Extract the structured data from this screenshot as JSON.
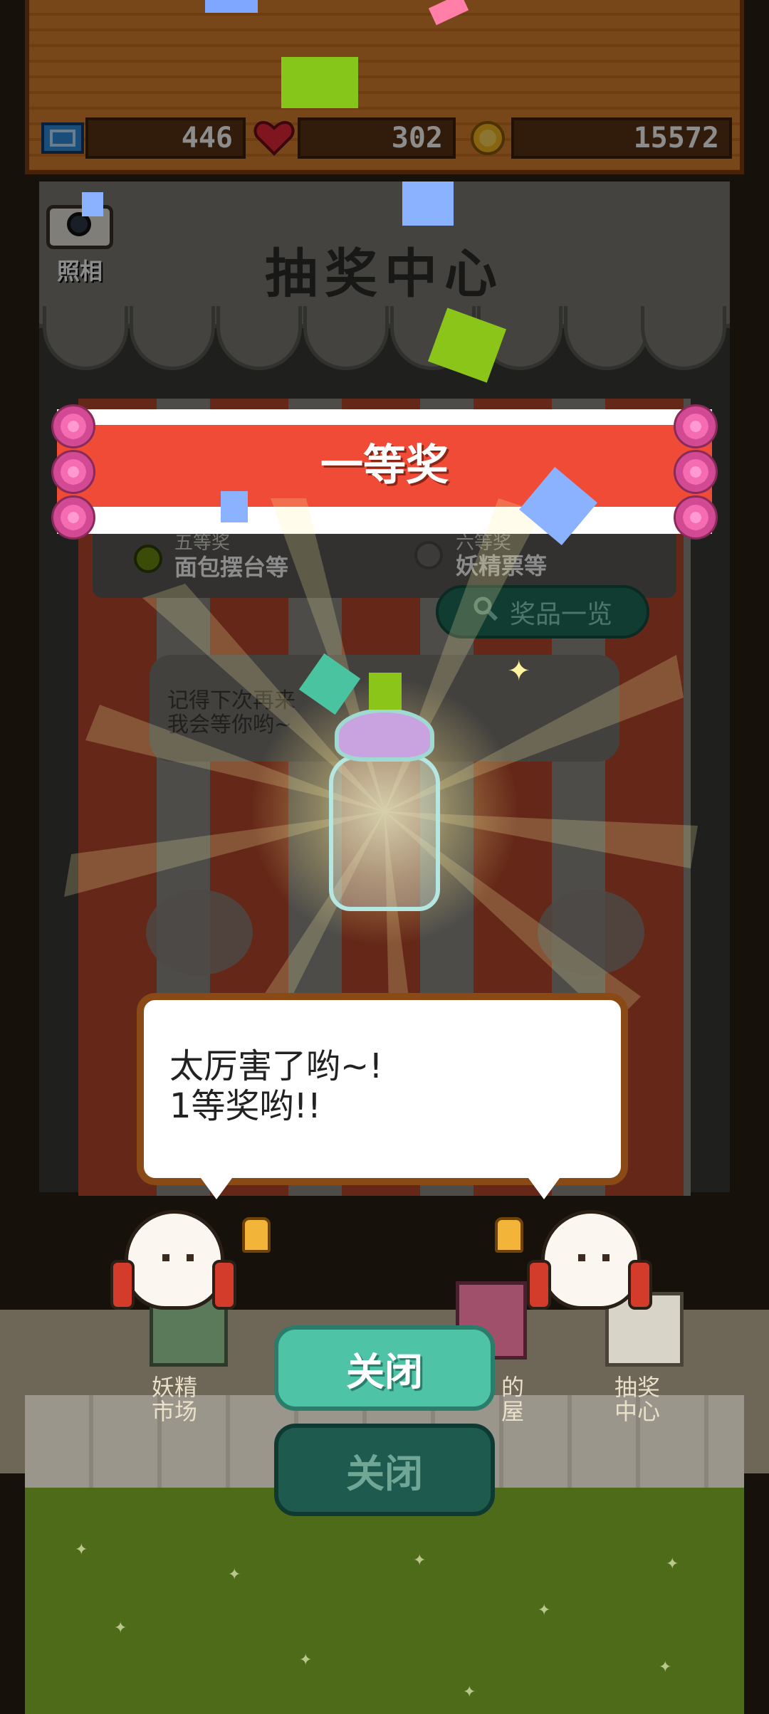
{
  "resources": {
    "tickets": "446",
    "hearts": "302",
    "coins": "15572"
  },
  "camera_label": "照相",
  "awning_title": "抽奖中心",
  "prize_banner": "一等奖",
  "prize_info": {
    "fifth": {
      "tier": "五等奖",
      "item": "面包摆台等"
    },
    "sixth": {
      "tier": "六等奖",
      "item": "妖精票等"
    }
  },
  "prize_list_button": "奖品一览",
  "hint_text": "记得下次再来\n我会等你哟~",
  "dialog_text": "太厉害了哟~!\n1等奖哟!!",
  "buildings": {
    "left": "妖精\n市场",
    "middle": "的\n屋",
    "right": "抽奖\n中心"
  },
  "buttons": {
    "close": "关闭",
    "close_secondary": "关闭"
  },
  "colors": {
    "banner_red": "#ef4b37",
    "button_teal": "#4ec3a6",
    "wood": "#d9822f"
  }
}
